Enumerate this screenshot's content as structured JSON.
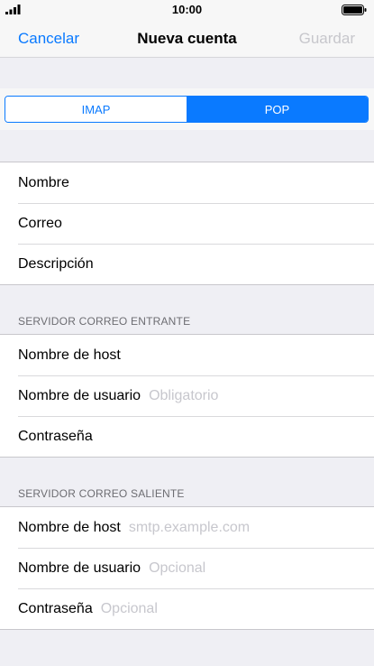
{
  "status_bar": {
    "time": "10:00",
    "signal_icon": "signal-icon",
    "battery_icon": "battery-icon"
  },
  "nav": {
    "cancel_label": "Cancelar",
    "title": "Nueva cuenta",
    "save_label": "Guardar"
  },
  "segmented": {
    "options": [
      "IMAP",
      "POP"
    ],
    "selected": "POP"
  },
  "account": {
    "name_label": "Nombre",
    "email_label": "Correo",
    "description_label": "Descripción"
  },
  "incoming": {
    "header": "SERVIDOR CORREO ENTRANTE",
    "host_label": "Nombre de host",
    "username_label": "Nombre de usuario",
    "username_placeholder": "Obligatorio",
    "password_label": "Contraseña"
  },
  "outgoing": {
    "header": "SERVIDOR CORREO SALIENTE",
    "host_label": "Nombre de host",
    "host_placeholder": "smtp.example.com",
    "username_label": "Nombre de usuario",
    "username_placeholder": "Opcional",
    "password_label": "Contraseña",
    "password_placeholder": "Opcional"
  },
  "colors": {
    "accent": "#0a7aff",
    "background": "#efeff4",
    "disabled": "#c7c7cc"
  }
}
